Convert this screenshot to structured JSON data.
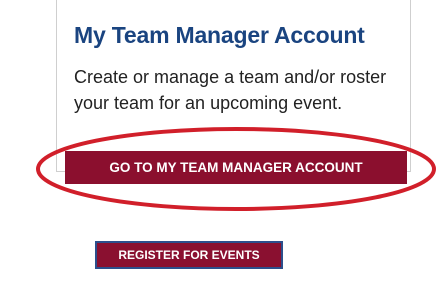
{
  "card": {
    "title": "My Team Manager Account",
    "description": "Create or manage a team and/or roster your team for an upcoming event.",
    "button_label": "GO TO MY TEAM MANAGER ACCOUNT"
  },
  "register_button_label": "REGISTER FOR EVENTS",
  "colors": {
    "title": "#1a4480",
    "button_bg": "#8b0f2e",
    "annotation": "#d11f2a",
    "register_border": "#2c4f8c"
  }
}
